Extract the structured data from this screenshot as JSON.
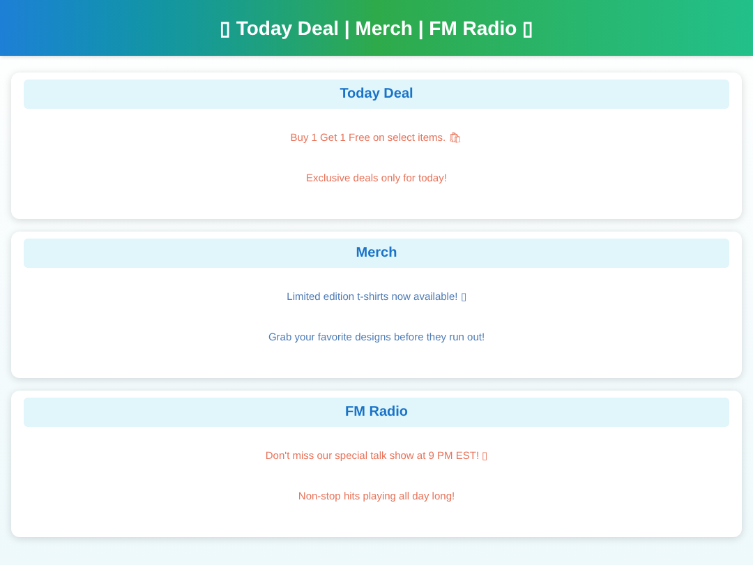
{
  "header": {
    "title": "▯ Today Deal | Merch | FM Radio ▯"
  },
  "sections": [
    {
      "title": "Today Deal",
      "color": "#e8735a",
      "messages": [
        "Buy 1 Get 1 Free on select items. 🛍",
        "Exclusive deals only for today!"
      ]
    },
    {
      "title": "Merch",
      "color": "#4f7db5",
      "messages": [
        "Limited edition t-shirts now available! ▯",
        "Grab your favorite designs before they run out!"
      ]
    },
    {
      "title": "FM Radio",
      "color": "#e8735a",
      "messages": [
        "Don't miss our special talk show at 9 PM EST! ▯",
        "Non-stop hits playing all day long!"
      ]
    }
  ]
}
